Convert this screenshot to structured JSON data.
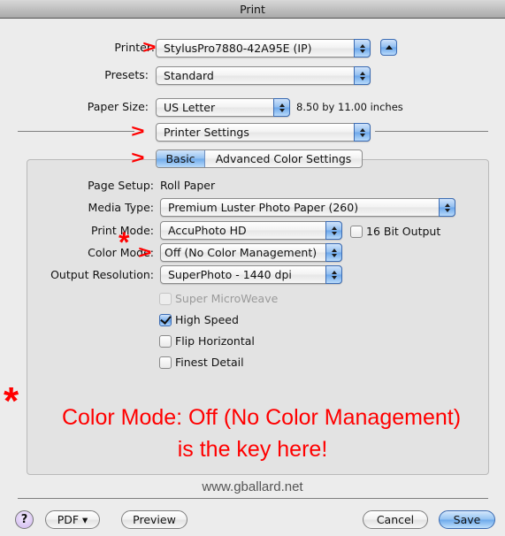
{
  "window": {
    "title": "Print"
  },
  "printer": {
    "label": "Printer:",
    "value": "StylusPro7880-42A95E (IP)"
  },
  "presets": {
    "label": "Presets:",
    "value": "Standard"
  },
  "paper_size": {
    "label": "Paper Size:",
    "value": "US Letter",
    "dimensions": "8.50 by 11.00 inches"
  },
  "panel_selector": {
    "value": "Printer Settings"
  },
  "tabs": [
    {
      "label": "Basic",
      "selected": true
    },
    {
      "label": "Advanced Color Settings",
      "selected": false
    }
  ],
  "settings": {
    "page_setup": {
      "label": "Page Setup:",
      "value": "Roll Paper"
    },
    "media_type": {
      "label": "Media Type:",
      "value": "Premium Luster Photo Paper (260)"
    },
    "print_mode": {
      "label": "Print Mode:",
      "value": "AccuPhoto HD"
    },
    "sixteen_bit": {
      "label": "16 Bit Output",
      "checked": false
    },
    "color_mode": {
      "label": "Color Mode:",
      "value": "Off (No Color Management)"
    },
    "output_resolution": {
      "label": "Output Resolution:",
      "value": "SuperPhoto - 1440 dpi"
    },
    "checkboxes": [
      {
        "label": "Super MicroWeave",
        "checked": false,
        "disabled": true
      },
      {
        "label": "High Speed",
        "checked": true,
        "disabled": false
      },
      {
        "label": "Flip Horizontal",
        "checked": false,
        "disabled": false
      },
      {
        "label": "Finest Detail",
        "checked": false,
        "disabled": false
      }
    ]
  },
  "annotation": {
    "arrow": ">",
    "star": "*",
    "line1": "Color Mode: Off (No Color Management)",
    "line2": "is the key here!",
    "color": "#ff0000"
  },
  "watermark": "www.gballard.net",
  "footer": {
    "help": "?",
    "pdf": "PDF ▾",
    "preview": "Preview",
    "cancel": "Cancel",
    "save": "Save"
  }
}
